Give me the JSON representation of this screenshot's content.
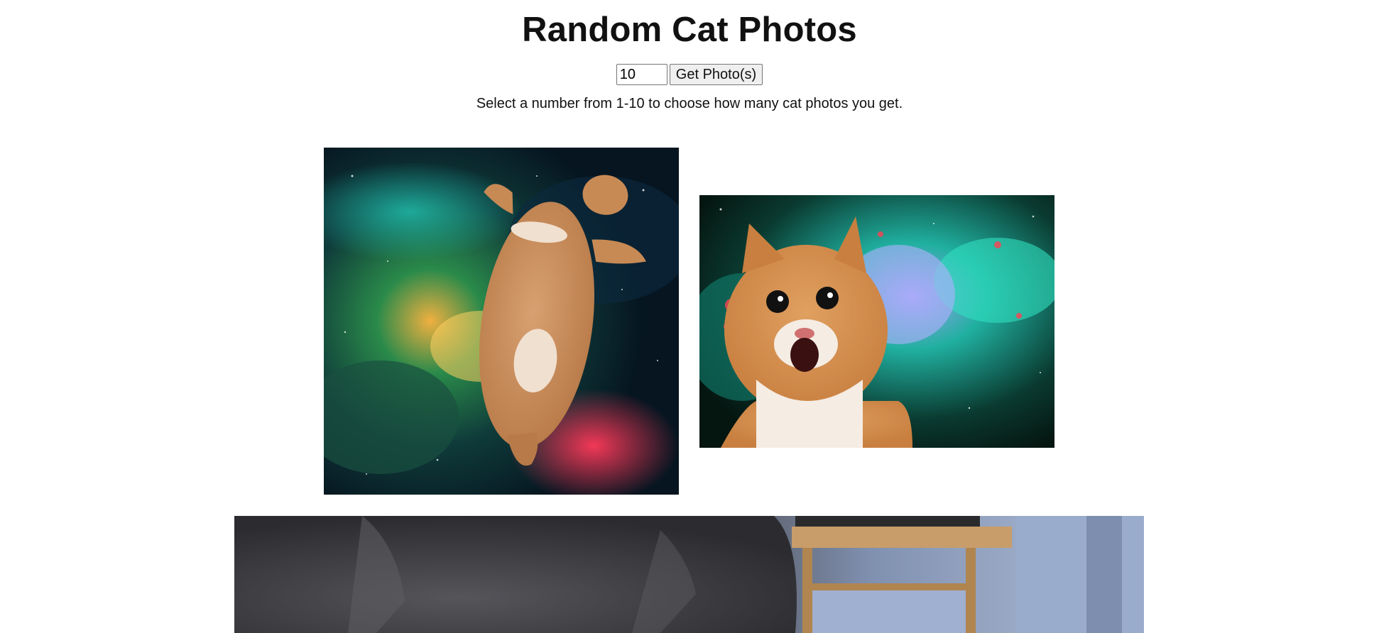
{
  "header": {
    "title": "Random Cat Photos"
  },
  "controls": {
    "count_value": "10",
    "button_label": "Get Photo(s)"
  },
  "instructions": "Select a number from 1-10 to choose how many cat photos you get.",
  "photos": [
    {
      "icon": "cat-in-space-photo"
    },
    {
      "icon": "surprised-cat-in-space-photo"
    },
    {
      "icon": "gray-cat-photo"
    }
  ]
}
